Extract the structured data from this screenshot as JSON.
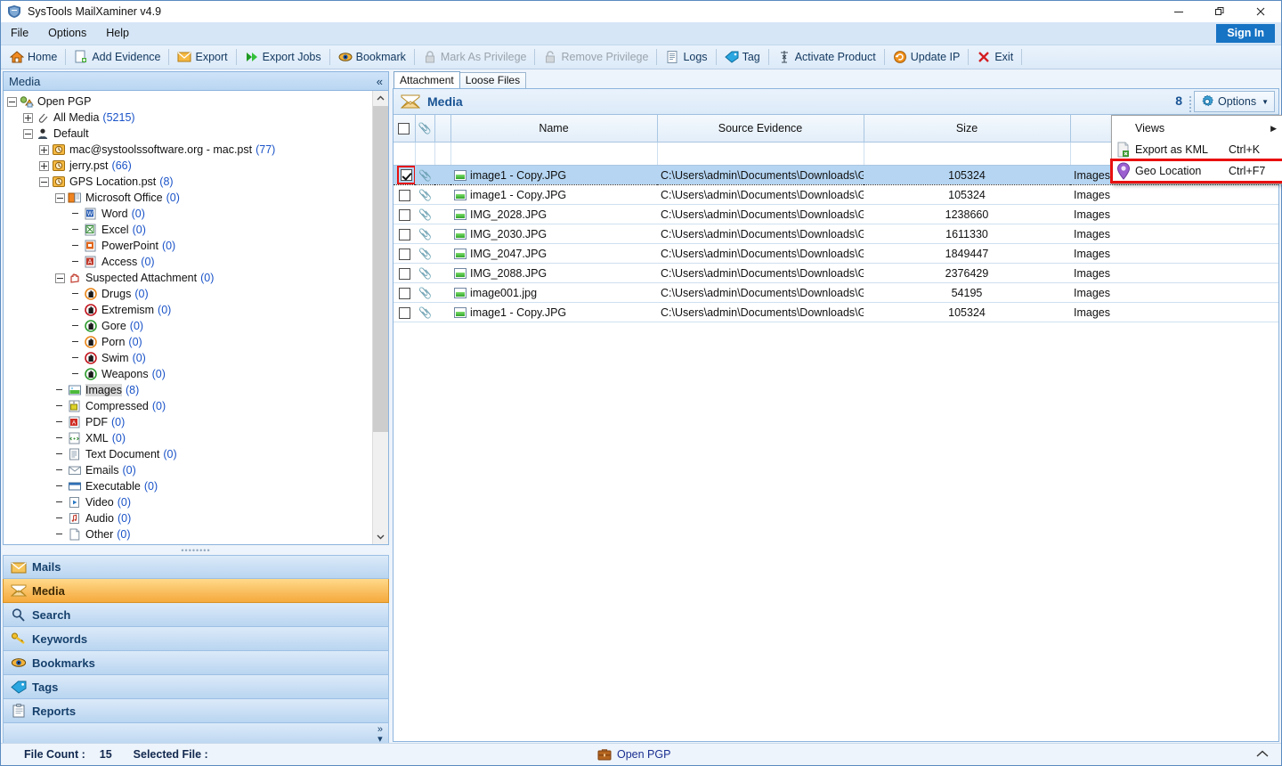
{
  "window": {
    "title": "SysTools MailXaminer v4.9",
    "icon": "app-shield-icon",
    "minimize": "—",
    "maximize": "❐",
    "close": "✕"
  },
  "menubar": {
    "items": [
      {
        "label": "File"
      },
      {
        "label": "Options"
      },
      {
        "label": "Help"
      }
    ],
    "sign_in": "Sign In"
  },
  "toolbar": {
    "items": [
      {
        "label": "Home",
        "icon": "home-icon",
        "disabled": false
      },
      {
        "label": "Add Evidence",
        "icon": "add-evidence-icon",
        "disabled": false
      },
      {
        "label": "Export",
        "icon": "export-envelope-icon",
        "disabled": false
      },
      {
        "label": "Export Jobs",
        "icon": "export-jobs-arrow-icon",
        "disabled": false
      },
      {
        "label": "Bookmark",
        "icon": "bookmark-eye-icon",
        "disabled": false
      },
      {
        "label": "Mark As Privilege",
        "icon": "lock-icon",
        "disabled": true
      },
      {
        "label": "Remove Privilege",
        "icon": "unlock-icon",
        "disabled": true
      },
      {
        "label": "Logs",
        "icon": "logs-document-icon",
        "disabled": false
      },
      {
        "label": "Tag",
        "icon": "tag-icon",
        "disabled": false
      },
      {
        "label": "Activate Product",
        "icon": "activate-key-icon",
        "disabled": false
      },
      {
        "label": "Update IP",
        "icon": "update-refresh-icon",
        "disabled": false
      },
      {
        "label": "Exit",
        "icon": "exit-cross-icon",
        "disabled": false
      }
    ]
  },
  "left_panel": {
    "header": {
      "title": "Media",
      "collapse_icon": "double-chevron-left-icon"
    },
    "tree": [
      {
        "depth": 0,
        "expander": "minus",
        "icon": "open-pgp-icon",
        "label": "Open PGP",
        "count": ""
      },
      {
        "depth": 1,
        "expander": "plus",
        "icon": "paperclip-icon",
        "label": "All Media",
        "count": "(5215)"
      },
      {
        "depth": 1,
        "expander": "minus",
        "icon": "user-icon",
        "label": "Default",
        "count": ""
      },
      {
        "depth": 2,
        "expander": "plus",
        "icon": "pst-clock-icon",
        "label": "mac@systoolssoftware.org - mac.pst",
        "count": "(77)"
      },
      {
        "depth": 2,
        "expander": "plus",
        "icon": "pst-clock-icon",
        "label": "jerry.pst",
        "count": "(66)"
      },
      {
        "depth": 2,
        "expander": "minus",
        "icon": "pst-clock-icon",
        "label": "GPS Location.pst",
        "count": "(8)"
      },
      {
        "depth": 3,
        "expander": "minus",
        "icon": "ms-office-icon",
        "label": "Microsoft Office",
        "count": "(0)"
      },
      {
        "depth": 4,
        "expander": "none",
        "icon": "word-icon",
        "label": "Word",
        "count": "(0)"
      },
      {
        "depth": 4,
        "expander": "none",
        "icon": "excel-icon",
        "label": "Excel",
        "count": "(0)"
      },
      {
        "depth": 4,
        "expander": "none",
        "icon": "powerpoint-icon",
        "label": "PowerPoint",
        "count": "(0)"
      },
      {
        "depth": 4,
        "expander": "none",
        "icon": "access-icon",
        "label": "Access",
        "count": "(0)"
      },
      {
        "depth": 3,
        "expander": "minus",
        "icon": "suspected-hand-icon",
        "label": "Suspected Attachment",
        "count": "(0)"
      },
      {
        "depth": 4,
        "expander": "none",
        "icon": "drugs-hand-icon",
        "label": "Drugs",
        "count": "(0)"
      },
      {
        "depth": 4,
        "expander": "none",
        "icon": "extremism-hand-icon",
        "label": "Extremism",
        "count": "(0)"
      },
      {
        "depth": 4,
        "expander": "none",
        "icon": "gore-hand-icon",
        "label": "Gore",
        "count": "(0)"
      },
      {
        "depth": 4,
        "expander": "none",
        "icon": "porn-hand-icon",
        "label": "Porn",
        "count": "(0)"
      },
      {
        "depth": 4,
        "expander": "none",
        "icon": "swim-hand-icon",
        "label": "Swim",
        "count": "(0)"
      },
      {
        "depth": 4,
        "expander": "none",
        "icon": "weapons-hand-icon",
        "label": "Weapons",
        "count": "(0)"
      },
      {
        "depth": 3,
        "expander": "none",
        "icon": "images-icon",
        "label": "Images",
        "count": "(8)",
        "selected": true
      },
      {
        "depth": 3,
        "expander": "none",
        "icon": "compressed-icon",
        "label": "Compressed",
        "count": "(0)"
      },
      {
        "depth": 3,
        "expander": "none",
        "icon": "pdf-icon",
        "label": "PDF",
        "count": "(0)"
      },
      {
        "depth": 3,
        "expander": "none",
        "icon": "xml-icon",
        "label": "XML",
        "count": "(0)"
      },
      {
        "depth": 3,
        "expander": "none",
        "icon": "text-document-icon",
        "label": "Text Document",
        "count": "(0)"
      },
      {
        "depth": 3,
        "expander": "none",
        "icon": "emails-icon",
        "label": "Emails",
        "count": "(0)"
      },
      {
        "depth": 3,
        "expander": "none",
        "icon": "executable-icon",
        "label": "Executable",
        "count": "(0)"
      },
      {
        "depth": 3,
        "expander": "none",
        "icon": "video-icon",
        "label": "Video",
        "count": "(0)"
      },
      {
        "depth": 3,
        "expander": "none",
        "icon": "audio-icon",
        "label": "Audio",
        "count": "(0)"
      },
      {
        "depth": 3,
        "expander": "none",
        "icon": "other-file-icon",
        "label": "Other",
        "count": "(0)"
      }
    ],
    "nav": [
      {
        "label": "Mails",
        "icon": "mails-envelope-icon",
        "active": false
      },
      {
        "label": "Media",
        "icon": "media-envelope-icon",
        "active": true
      },
      {
        "label": "Search",
        "icon": "search-magnifier-icon",
        "active": false
      },
      {
        "label": "Keywords",
        "icon": "keywords-key-icon",
        "active": false
      },
      {
        "label": "Bookmarks",
        "icon": "bookmarks-eye-icon",
        "active": false
      },
      {
        "label": "Tags",
        "icon": "tags-icon",
        "active": false
      },
      {
        "label": "Reports",
        "icon": "reports-clipboard-icon",
        "active": false
      }
    ],
    "nav_expand_icon": "double-chevron-right-icon"
  },
  "right_panel": {
    "tabs": [
      {
        "label": "Attachment",
        "active": true
      },
      {
        "label": "Loose Files",
        "active": false
      }
    ],
    "grid_header": {
      "icon": "media-envelope-icon",
      "title": "Media",
      "count": "8",
      "options_label": "Options",
      "options_icon": "gear-icon",
      "options_caret": "▼"
    },
    "columns": [
      {
        "key": "check",
        "label": ""
      },
      {
        "key": "clip",
        "label": ""
      },
      {
        "key": "ic",
        "label": ""
      },
      {
        "key": "name",
        "label": "Name"
      },
      {
        "key": "source",
        "label": "Source Evidence"
      },
      {
        "key": "size",
        "label": "Size"
      },
      {
        "key": "category",
        "label": ""
      }
    ],
    "rows": [
      {
        "checked": true,
        "highlighted": true,
        "name": "image1 - Copy.JPG",
        "source": "C:\\Users\\admin\\Documents\\Downloads\\GPS...",
        "size": "105324",
        "category": "Images"
      },
      {
        "checked": false,
        "highlighted": false,
        "name": "image1 - Copy.JPG",
        "source": "C:\\Users\\admin\\Documents\\Downloads\\GPS...",
        "size": "105324",
        "category": "Images"
      },
      {
        "checked": false,
        "highlighted": false,
        "name": "IMG_2028.JPG",
        "source": "C:\\Users\\admin\\Documents\\Downloads\\GPS...",
        "size": "1238660",
        "category": "Images"
      },
      {
        "checked": false,
        "highlighted": false,
        "name": "IMG_2030.JPG",
        "source": "C:\\Users\\admin\\Documents\\Downloads\\GPS...",
        "size": "1611330",
        "category": "Images"
      },
      {
        "checked": false,
        "highlighted": false,
        "name": "IMG_2047.JPG",
        "source": "C:\\Users\\admin\\Documents\\Downloads\\GPS...",
        "size": "1849447",
        "category": "Images"
      },
      {
        "checked": false,
        "highlighted": false,
        "name": "IMG_2088.JPG",
        "source": "C:\\Users\\admin\\Documents\\Downloads\\GPS...",
        "size": "2376429",
        "category": "Images"
      },
      {
        "checked": false,
        "highlighted": false,
        "name": "image001.jpg",
        "source": "C:\\Users\\admin\\Documents\\Downloads\\GPS...",
        "size": "54195",
        "category": "Images"
      },
      {
        "checked": false,
        "highlighted": false,
        "name": "image1 - Copy.JPG",
        "source": "C:\\Users\\admin\\Documents\\Downloads\\GPS...",
        "size": "105324",
        "category": "Images"
      }
    ]
  },
  "options_menu": {
    "items": [
      {
        "label": "Views",
        "shortcut": "",
        "icon": "",
        "submenu_arrow": "▶",
        "highlighted": false
      },
      {
        "label": "Export as KML",
        "shortcut": "Ctrl+K",
        "icon": "kml-file-icon",
        "submenu_arrow": "",
        "highlighted": false
      },
      {
        "label": "Geo Location",
        "shortcut": "Ctrl+F7",
        "icon": "map-pin-icon",
        "submenu_arrow": "",
        "highlighted": true
      }
    ]
  },
  "status_bar": {
    "file_count_label": "File Count :",
    "file_count_value": "15",
    "selected_file_label": "Selected File :",
    "evidence_icon": "briefcase-icon",
    "evidence_label": "Open PGP",
    "expand_icon": "chevron-up-icon"
  },
  "colors": {
    "accent": "#1773c4",
    "highlight_row": "#b5d5f2",
    "menu_highlight_border": "#e8100f",
    "nav_active": "#f5a93c",
    "count_text": "#1a53c8"
  }
}
